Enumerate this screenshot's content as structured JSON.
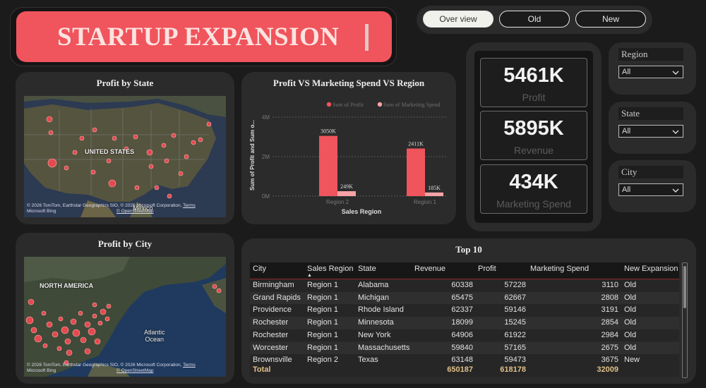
{
  "header": {
    "title": "STARTUP EXPANSION"
  },
  "nav": {
    "tabs": [
      "Over view",
      "Old",
      "New"
    ],
    "active": 0
  },
  "map_state": {
    "title": "Profit by State",
    "country_label": "UNITED STATES",
    "mexico_label": "Mexico",
    "credit_line1": "© 2026 TomTom, Earthstar Geographics SIO, © 2026 Microsoft Corporation,",
    "credit_terms": "Terms",
    "credit_line2": "Microsoft Bing",
    "credit_osm": "© OpenStreetMap"
  },
  "map_city": {
    "title": "Profit by City",
    "region_label": "NORTH AMERICA",
    "ocean_label1": "Atlantic",
    "ocean_label2": "Ocean",
    "credit_line1": "© 2026 TomTom, Earthstar Geographics SIO, © 2026 Microsoft Corporation,",
    "credit_terms": "Terms",
    "credit_line2": "Microsoft Bing",
    "credit_osm": "© OpenStreetMap"
  },
  "chart_data": {
    "type": "bar",
    "title": "Profit VS Marketing Spend VS Region",
    "xlabel": "Sales Region",
    "ylabel": "Sum of Profit and Sum o...",
    "categories": [
      "Region 2",
      "Region 1"
    ],
    "series": [
      {
        "name": "Sum of Profit",
        "values": [
          3050,
          2411
        ],
        "labels": [
          "3050K",
          "2411K"
        ],
        "color": "#f0545c"
      },
      {
        "name": "Sum of Marketing Spend",
        "values": [
          249,
          185
        ],
        "labels": [
          "249K",
          "185K"
        ],
        "color": "#f5a3a6"
      }
    ],
    "yticks": [
      "0M",
      "2M",
      "4M"
    ],
    "ylim": [
      0,
      4000
    ],
    "legend": "top-right",
    "grid": true
  },
  "kpis": [
    {
      "value": "5461K",
      "label": "Profit"
    },
    {
      "value": "5895K",
      "label": "Revenue"
    },
    {
      "value": "434K",
      "label": "Marketing Spend"
    }
  ],
  "slicers": [
    {
      "label": "Region",
      "value": "All"
    },
    {
      "label": "State",
      "value": "All"
    },
    {
      "label": "City",
      "value": "All"
    }
  ],
  "table": {
    "title": "Top 10",
    "columns": [
      "City",
      "Sales Region",
      "State",
      "Revenue",
      "Profit",
      "Marketing Spend",
      "New Expansion"
    ],
    "sort_indicator": "▲",
    "rows": [
      [
        "Birmingham",
        "Region 1",
        "Alabama",
        "60338",
        "57228",
        "3110",
        "Old"
      ],
      [
        "Grand Rapids",
        "Region 1",
        "Michigan",
        "65475",
        "62667",
        "2808",
        "Old"
      ],
      [
        "Providence",
        "Region 1",
        "Rhode Island",
        "62337",
        "59146",
        "3191",
        "Old"
      ],
      [
        "Rochester",
        "Region 1",
        "Minnesota",
        "18099",
        "15245",
        "2854",
        "Old"
      ],
      [
        "Rochester",
        "Region 1",
        "New York",
        "64906",
        "61922",
        "2984",
        "Old"
      ],
      [
        "Worcester",
        "Region 1",
        "Massachusetts",
        "59840",
        "57165",
        "2675",
        "Old"
      ],
      [
        "Brownsville",
        "Region 2",
        "Texas",
        "63148",
        "59473",
        "3675",
        "New"
      ]
    ],
    "total": {
      "label": "Total",
      "revenue": "650187",
      "profit": "618178",
      "marketing": "32009"
    }
  },
  "colors": {
    "accent": "#f0545c",
    "accent_light": "#f5a3a6",
    "panel": "#2b2b2b",
    "background": "#1b1b1b"
  }
}
